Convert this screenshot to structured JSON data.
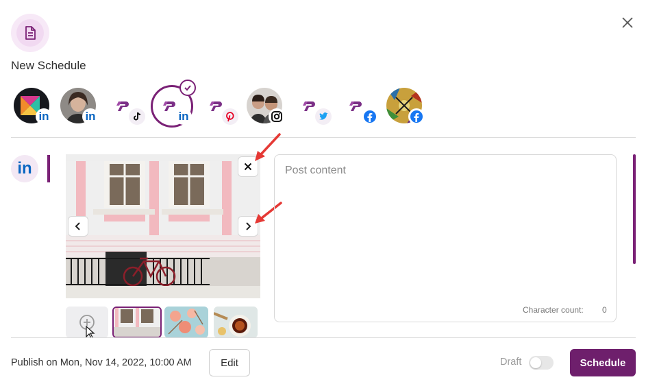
{
  "header": {
    "icon": "document-icon",
    "title": "New Schedule",
    "close_icon": "close-icon"
  },
  "accounts": [
    {
      "name": "account-1",
      "network": "linkedin",
      "badge_text": "in",
      "selected": false
    },
    {
      "name": "account-2",
      "network": "linkedin",
      "badge_text": "in",
      "selected": false
    },
    {
      "name": "account-3",
      "network": "tiktok",
      "selected": false
    },
    {
      "name": "account-4",
      "network": "linkedin",
      "badge_text": "in",
      "selected": true
    },
    {
      "name": "account-5",
      "network": "pinterest",
      "selected": false
    },
    {
      "name": "account-6",
      "network": "instagram",
      "selected": false
    },
    {
      "name": "account-7",
      "network": "twitter",
      "selected": false
    },
    {
      "name": "account-8",
      "network": "facebook",
      "selected": false
    },
    {
      "name": "account-9",
      "network": "facebook",
      "selected": false
    }
  ],
  "editor": {
    "network_icon_text": "in",
    "post_placeholder": "Post content",
    "character_count_label": "Character count:",
    "character_count_value": "0"
  },
  "footer": {
    "publish_text": "Publish on Mon, Nov 14, 2022, 10:00 AM",
    "edit_label": "Edit",
    "draft_label": "Draft",
    "draft_enabled": false,
    "schedule_label": "Schedule"
  },
  "colors": {
    "brand": "#6e1f6c",
    "linkedin": "#0a66c2",
    "annotation_arrow": "#e53935"
  }
}
